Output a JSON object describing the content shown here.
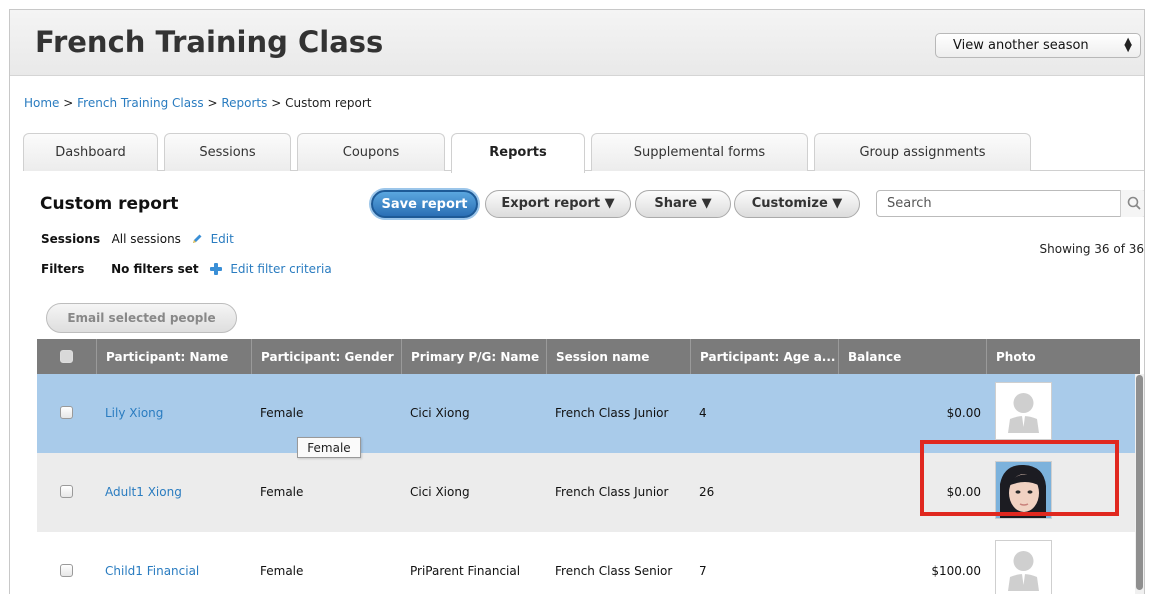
{
  "header": {
    "title": "French Training Class",
    "season_select": {
      "value": "View another season"
    }
  },
  "breadcrumb": [
    {
      "label": "Home",
      "link": true
    },
    {
      "label": ">",
      "link": false
    },
    {
      "label": "French Training Class",
      "link": true
    },
    {
      "label": ">",
      "link": false
    },
    {
      "label": "Reports",
      "link": true
    },
    {
      "label": ">",
      "link": false
    },
    {
      "label": "Custom report",
      "link": false
    }
  ],
  "tabs": [
    {
      "label": "Dashboard",
      "active": false
    },
    {
      "label": "Sessions",
      "active": false
    },
    {
      "label": "Coupons",
      "active": false
    },
    {
      "label": "Reports",
      "active": true
    },
    {
      "label": "Supplemental forms",
      "active": false
    },
    {
      "label": "Group assignments",
      "active": false
    }
  ],
  "report": {
    "title": "Custom report",
    "buttons": {
      "save": "Save report",
      "export": "Export report ▼",
      "share": "Share ▼",
      "customize": "Customize ▼"
    },
    "search_placeholder": "Search",
    "sessions_label": "Sessions",
    "sessions_value": "All sessions",
    "sessions_edit": "Edit",
    "filters_label": "Filters",
    "filters_value": "No filters set",
    "filters_edit": "Edit filter criteria",
    "showing": "Showing 36 of 36",
    "email_button": "Email selected people"
  },
  "table": {
    "columns": [
      "Participant: Name",
      "Participant: Gender",
      "Primary P/G: Name",
      "Session name",
      "Participant: Age a...",
      "Balance",
      "Photo"
    ],
    "rows": [
      {
        "name": "Lily Xiong",
        "gender": "Female",
        "pg_name": "Cici Xiong",
        "session": "French Class Junior",
        "age": "4",
        "balance": "$0.00",
        "photo": "placeholder-avatar",
        "selected": true
      },
      {
        "name": "Adult1 Xiong",
        "gender": "Female",
        "pg_name": "Cici Xiong",
        "session": "French Class Junior",
        "age": "26",
        "balance": "$0.00",
        "photo": "portrait",
        "selected": false
      },
      {
        "name": "Child1 Financial",
        "gender": "Female",
        "pg_name": "PriParent Financial",
        "session": "French Class Senior",
        "age": "7",
        "balance": "$100.00",
        "photo": "placeholder-avatar",
        "selected": false
      }
    ]
  },
  "tooltip": {
    "text": "Female"
  },
  "colors": {
    "link": "#2a7cc0",
    "selected_row": "#a9cbea",
    "alt_row": "#ececec",
    "header_row": "#7b7b7b",
    "save_button": "#2a6fb5",
    "highlight_box": "#e0281f"
  }
}
